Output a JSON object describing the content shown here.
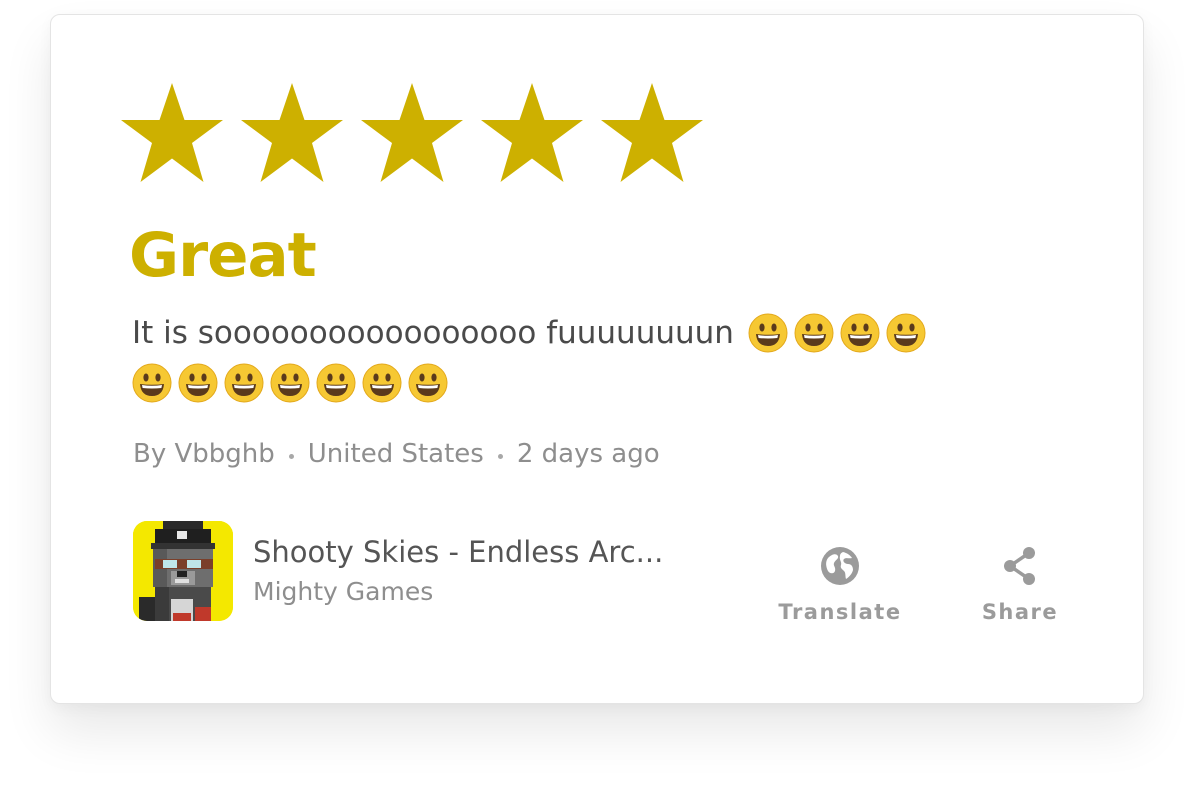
{
  "review": {
    "rating": 5,
    "max_rating": 5,
    "star_color": "#cdb000",
    "title": "Great",
    "body_text": "It is sooooooooooooooooo fuuuuuuuun",
    "emoji_name": "grinning-face",
    "emoji_count_line1": 4,
    "emoji_count_line2": 7,
    "author": "By Vbbghb",
    "country": "United States",
    "time": "2 days ago"
  },
  "app": {
    "name": "Shooty Skies - Endless Arc...",
    "developer": "Mighty Games",
    "icon": "shooty-skies-app-icon"
  },
  "actions": {
    "translate_label": "Translate",
    "translate_icon": "globe-icon",
    "share_label": "Share",
    "share_icon": "share-icon"
  }
}
